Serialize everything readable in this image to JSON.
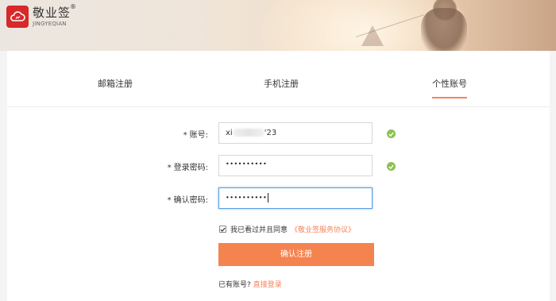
{
  "brand": {
    "name": "敬业签",
    "reg": "®",
    "subtitle": "JINGYEQIAN",
    "accent": "#d7282a"
  },
  "tabs": [
    {
      "label": "邮箱注册",
      "active": false
    },
    {
      "label": "手机注册",
      "active": false
    },
    {
      "label": "个性账号",
      "active": true
    }
  ],
  "form": {
    "account": {
      "label": "账号:",
      "required": "*",
      "value_prefix": "xi",
      "value_suffix": "'23",
      "valid": true
    },
    "password": {
      "label": "登录密码:",
      "required": "*",
      "value": "••••••••••",
      "valid": true
    },
    "confirm": {
      "label": "确认密码:",
      "required": "*",
      "value": "••••••••••",
      "focused": true
    }
  },
  "agreement": {
    "checked": true,
    "text": "我已看过并且同意",
    "link": "《敬业签服务协议》"
  },
  "submit_label": "确认注册",
  "login": {
    "prompt": "已有账号?",
    "link": "直接登录"
  },
  "colors": {
    "primary": "#f5834f",
    "valid": "#8cc152",
    "focus": "#5a9be0"
  }
}
